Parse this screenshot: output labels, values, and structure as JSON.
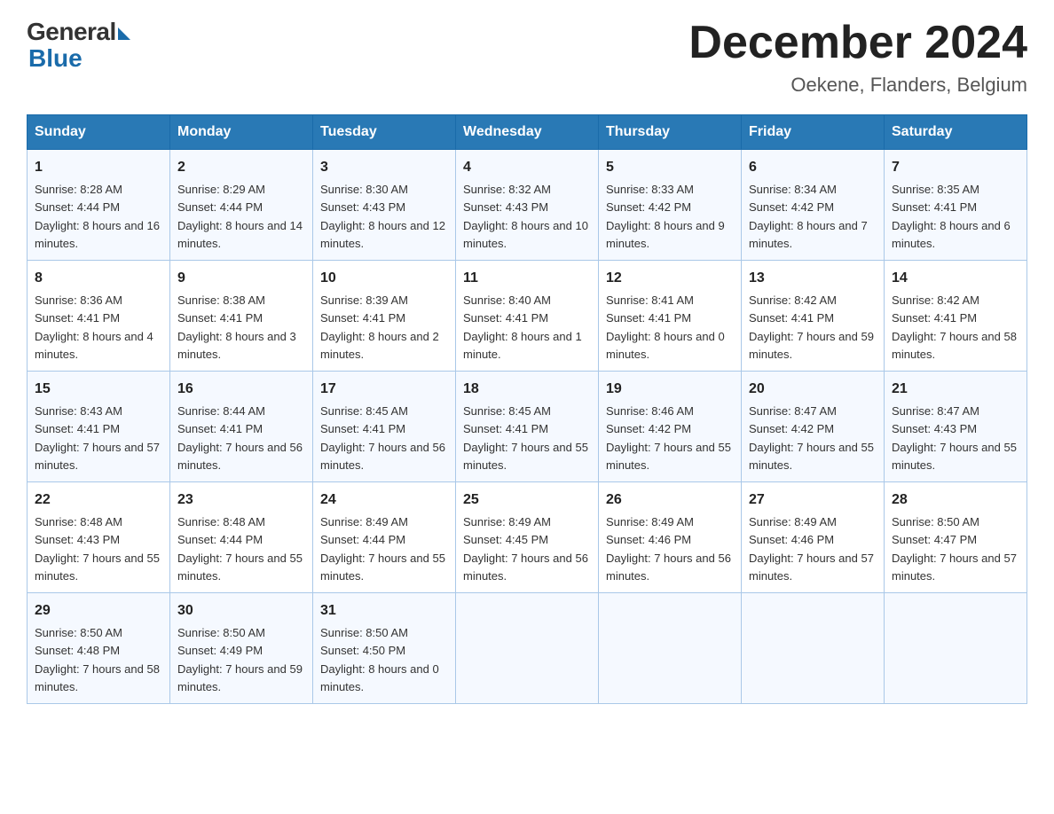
{
  "logo": {
    "general": "General",
    "blue": "Blue"
  },
  "title": {
    "month_year": "December 2024",
    "location": "Oekene, Flanders, Belgium"
  },
  "headers": [
    "Sunday",
    "Monday",
    "Tuesday",
    "Wednesday",
    "Thursday",
    "Friday",
    "Saturday"
  ],
  "weeks": [
    [
      {
        "day": "1",
        "sunrise": "8:28 AM",
        "sunset": "4:44 PM",
        "daylight": "8 hours and 16 minutes."
      },
      {
        "day": "2",
        "sunrise": "8:29 AM",
        "sunset": "4:44 PM",
        "daylight": "8 hours and 14 minutes."
      },
      {
        "day": "3",
        "sunrise": "8:30 AM",
        "sunset": "4:43 PM",
        "daylight": "8 hours and 12 minutes."
      },
      {
        "day": "4",
        "sunrise": "8:32 AM",
        "sunset": "4:43 PM",
        "daylight": "8 hours and 10 minutes."
      },
      {
        "day": "5",
        "sunrise": "8:33 AM",
        "sunset": "4:42 PM",
        "daylight": "8 hours and 9 minutes."
      },
      {
        "day": "6",
        "sunrise": "8:34 AM",
        "sunset": "4:42 PM",
        "daylight": "8 hours and 7 minutes."
      },
      {
        "day": "7",
        "sunrise": "8:35 AM",
        "sunset": "4:41 PM",
        "daylight": "8 hours and 6 minutes."
      }
    ],
    [
      {
        "day": "8",
        "sunrise": "8:36 AM",
        "sunset": "4:41 PM",
        "daylight": "8 hours and 4 minutes."
      },
      {
        "day": "9",
        "sunrise": "8:38 AM",
        "sunset": "4:41 PM",
        "daylight": "8 hours and 3 minutes."
      },
      {
        "day": "10",
        "sunrise": "8:39 AM",
        "sunset": "4:41 PM",
        "daylight": "8 hours and 2 minutes."
      },
      {
        "day": "11",
        "sunrise": "8:40 AM",
        "sunset": "4:41 PM",
        "daylight": "8 hours and 1 minute."
      },
      {
        "day": "12",
        "sunrise": "8:41 AM",
        "sunset": "4:41 PM",
        "daylight": "8 hours and 0 minutes."
      },
      {
        "day": "13",
        "sunrise": "8:42 AM",
        "sunset": "4:41 PM",
        "daylight": "7 hours and 59 minutes."
      },
      {
        "day": "14",
        "sunrise": "8:42 AM",
        "sunset": "4:41 PM",
        "daylight": "7 hours and 58 minutes."
      }
    ],
    [
      {
        "day": "15",
        "sunrise": "8:43 AM",
        "sunset": "4:41 PM",
        "daylight": "7 hours and 57 minutes."
      },
      {
        "day": "16",
        "sunrise": "8:44 AM",
        "sunset": "4:41 PM",
        "daylight": "7 hours and 56 minutes."
      },
      {
        "day": "17",
        "sunrise": "8:45 AM",
        "sunset": "4:41 PM",
        "daylight": "7 hours and 56 minutes."
      },
      {
        "day": "18",
        "sunrise": "8:45 AM",
        "sunset": "4:41 PM",
        "daylight": "7 hours and 55 minutes."
      },
      {
        "day": "19",
        "sunrise": "8:46 AM",
        "sunset": "4:42 PM",
        "daylight": "7 hours and 55 minutes."
      },
      {
        "day": "20",
        "sunrise": "8:47 AM",
        "sunset": "4:42 PM",
        "daylight": "7 hours and 55 minutes."
      },
      {
        "day": "21",
        "sunrise": "8:47 AM",
        "sunset": "4:43 PM",
        "daylight": "7 hours and 55 minutes."
      }
    ],
    [
      {
        "day": "22",
        "sunrise": "8:48 AM",
        "sunset": "4:43 PM",
        "daylight": "7 hours and 55 minutes."
      },
      {
        "day": "23",
        "sunrise": "8:48 AM",
        "sunset": "4:44 PM",
        "daylight": "7 hours and 55 minutes."
      },
      {
        "day": "24",
        "sunrise": "8:49 AM",
        "sunset": "4:44 PM",
        "daylight": "7 hours and 55 minutes."
      },
      {
        "day": "25",
        "sunrise": "8:49 AM",
        "sunset": "4:45 PM",
        "daylight": "7 hours and 56 minutes."
      },
      {
        "day": "26",
        "sunrise": "8:49 AM",
        "sunset": "4:46 PM",
        "daylight": "7 hours and 56 minutes."
      },
      {
        "day": "27",
        "sunrise": "8:49 AM",
        "sunset": "4:46 PM",
        "daylight": "7 hours and 57 minutes."
      },
      {
        "day": "28",
        "sunrise": "8:50 AM",
        "sunset": "4:47 PM",
        "daylight": "7 hours and 57 minutes."
      }
    ],
    [
      {
        "day": "29",
        "sunrise": "8:50 AM",
        "sunset": "4:48 PM",
        "daylight": "7 hours and 58 minutes."
      },
      {
        "day": "30",
        "sunrise": "8:50 AM",
        "sunset": "4:49 PM",
        "daylight": "7 hours and 59 minutes."
      },
      {
        "day": "31",
        "sunrise": "8:50 AM",
        "sunset": "4:50 PM",
        "daylight": "8 hours and 0 minutes."
      },
      {
        "day": "",
        "sunrise": "",
        "sunset": "",
        "daylight": ""
      },
      {
        "day": "",
        "sunrise": "",
        "sunset": "",
        "daylight": ""
      },
      {
        "day": "",
        "sunrise": "",
        "sunset": "",
        "daylight": ""
      },
      {
        "day": "",
        "sunrise": "",
        "sunset": "",
        "daylight": ""
      }
    ]
  ]
}
